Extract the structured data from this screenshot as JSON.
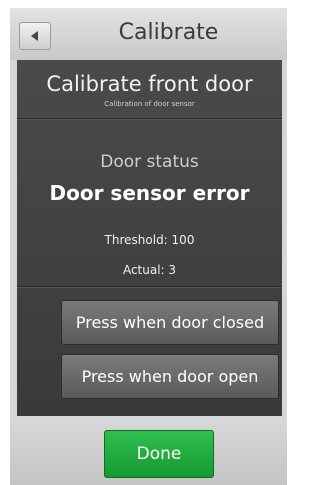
{
  "header": {
    "title": "Calibrate",
    "back_icon": "back-arrow-icon"
  },
  "panel": {
    "title": "Calibrate front door",
    "subtitle": "Calibration of door sensor",
    "door_status_label": "Door status",
    "door_status_value": "Door sensor error",
    "threshold": "Threshold: 100",
    "actual": "Actual: 3"
  },
  "buttons": {
    "door_closed": "Press when door closed",
    "door_open": "Press when door open",
    "done": "Done"
  },
  "colors": {
    "panel_background": "#404040",
    "done_green": "#22a83e",
    "action_button": "#6a6a6a"
  }
}
